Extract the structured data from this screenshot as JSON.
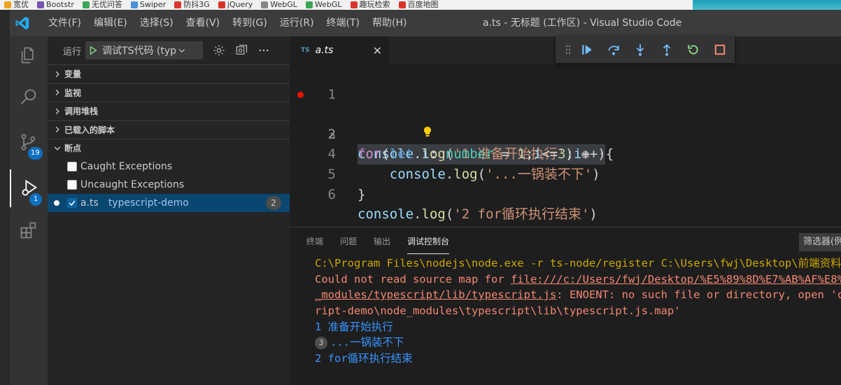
{
  "browser_bookmarks": [
    "宽优",
    "Bootstr",
    "无优问答",
    "Swiper",
    "防抖3G",
    "jQuery",
    "WebGL",
    "WebGL",
    "趣玩检索",
    "百度地图"
  ],
  "titlebar": {
    "menu": [
      "文件(F)",
      "编辑(E)",
      "选择(S)",
      "查看(V)",
      "转到(G)",
      "运行(R)",
      "终端(T)",
      "帮助(H)"
    ],
    "window_title": "a.ts - 无标题 (工作区) - Visual Studio Code"
  },
  "activitybar": {
    "scm_badge": "19",
    "debug_badge": "1"
  },
  "sidebar": {
    "run_label": "运行",
    "config_name": "调试TS代码 (typ",
    "sections": [
      "变量",
      "监视",
      "调用堆栈",
      "已载入的脚本",
      "断点"
    ],
    "breakpoints": [
      {
        "label": "Caught Exceptions",
        "checked": false
      },
      {
        "label": "Uncaught Exceptions",
        "checked": false
      }
    ],
    "file_breakpoint": {
      "file": "a.ts",
      "folder": "typescript-demo",
      "count": "2"
    }
  },
  "editor": {
    "tab": {
      "badge": "TS",
      "name": "a.ts"
    },
    "line_numbers": [
      "1",
      "2",
      "3",
      "4",
      "5",
      "6"
    ]
  },
  "panel": {
    "tabs": [
      "终端",
      "问题",
      "输出",
      "调试控制台"
    ],
    "filter_placeholder": "筛选器(例",
    "console": {
      "cmd": "C:\\Program Files\\nodejs\\node.exe -r ts-node/register C:\\Users\\fwj\\Desktop\\前端资料",
      "err1_prefix": "Could not read source map for ",
      "err1_link": "file:///c:/Users/fwj/Desktop/%E5%89%8D%E7%AB%AF%E8%B",
      "err2_link": "_modules/typescript/lib/typescript.js",
      "err2_rest": ": ENOENT: no such file or directory, open 'c",
      "err3": "ript-demo\\node_modules\\typescript\\lib\\typescript.js.map'",
      "out1": "1 准备开始执行",
      "out2_count": "3",
      "out2": "...一锅装不下",
      "out3": "2 for循环执行结束"
    }
  },
  "colors": {
    "accent": "#0e70c0",
    "breakpoint": "#e51400",
    "error_text": "#f48771",
    "warning_text": "#cca700",
    "info_text": "#3794ff"
  }
}
